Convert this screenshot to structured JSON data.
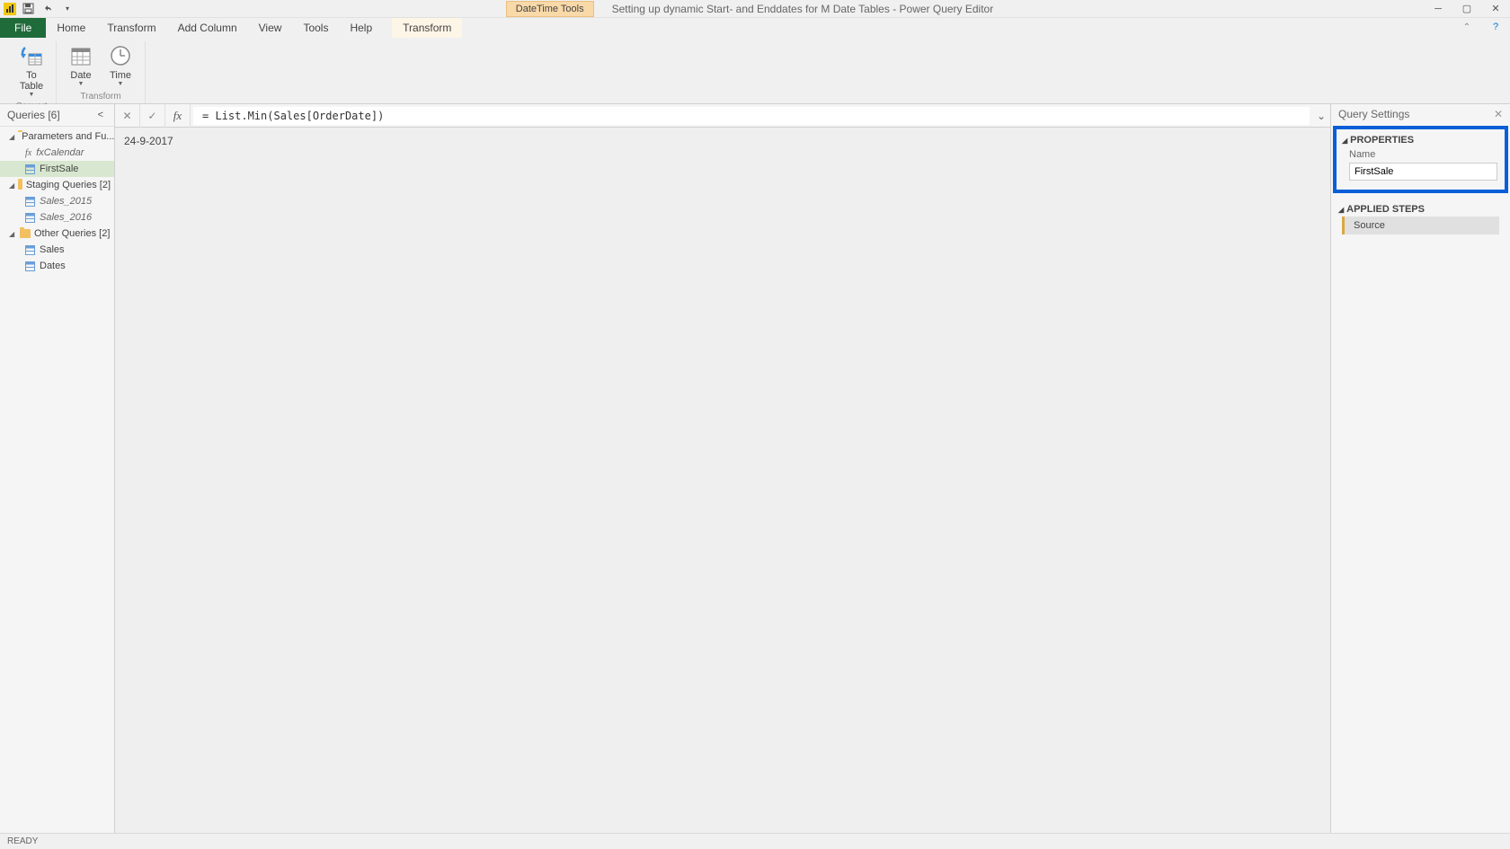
{
  "titlebar": {
    "context_label": "DateTime Tools",
    "title": "Setting up dynamic Start- and Enddates for M Date Tables - Power Query Editor"
  },
  "tabs": {
    "file": "File",
    "home": "Home",
    "transform": "Transform",
    "add_column": "Add Column",
    "view": "View",
    "tools": "Tools",
    "help": "Help",
    "context_transform": "Transform"
  },
  "ribbon": {
    "to_table": "To\nTable",
    "date": "Date",
    "time": "Time",
    "group_convert": "Convert",
    "group_transform": "Transform"
  },
  "queries": {
    "header": "Queries [6]",
    "groups": [
      {
        "label": "Parameters and Fu...",
        "items": [
          {
            "label": "fxCalendar",
            "type": "fx",
            "italic": true
          },
          {
            "label": "FirstSale",
            "type": "table",
            "selected": true
          }
        ]
      },
      {
        "label": "Staging Queries [2]",
        "items": [
          {
            "label": "Sales_2015",
            "type": "table",
            "italic": true
          },
          {
            "label": "Sales_2016",
            "type": "table",
            "italic": true
          }
        ]
      },
      {
        "label": "Other Queries [2]",
        "items": [
          {
            "label": "Sales",
            "type": "table"
          },
          {
            "label": "Dates",
            "type": "table"
          }
        ]
      }
    ]
  },
  "formula": "= List.Min(Sales[OrderDate])",
  "preview_value": "24-9-2017",
  "settings": {
    "title": "Query Settings",
    "properties_label": "PROPERTIES",
    "name_label": "Name",
    "name_value": "FirstSale",
    "steps_label": "APPLIED STEPS",
    "steps": [
      "Source"
    ]
  },
  "status": "READY"
}
